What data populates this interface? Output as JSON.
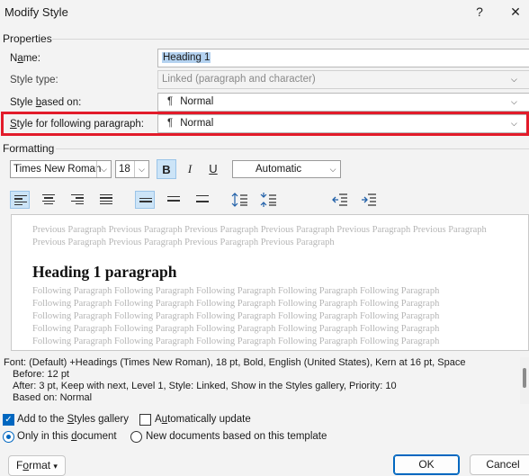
{
  "window": {
    "title": "Modify Style",
    "help_glyph": "?",
    "close_glyph": "✕"
  },
  "properties": {
    "section_label": "Properties",
    "name_label_pre": "N",
    "name_label_u": "a",
    "name_label_post": "me:",
    "name_value": "Heading 1",
    "style_type_label": "Style type:",
    "style_type_value": "Linked (paragraph and character)",
    "based_on_label_pre": "Style ",
    "based_on_label_u": "b",
    "based_on_label_post": "ased on:",
    "based_on_value": "Normal",
    "following_label_pre": "",
    "following_label_u": "S",
    "following_label_post": "tyle for following paragraph:",
    "following_value": "Normal",
    "pilcrow": "¶"
  },
  "formatting": {
    "section_label": "Formatting",
    "font_name": "Times New Roman",
    "font_size": "18",
    "bold": "B",
    "italic": "I",
    "underline": "U",
    "color": "Automatic"
  },
  "preview": {
    "previous_text": "Previous Paragraph Previous Paragraph Previous Paragraph Previous Paragraph Previous Paragraph Previous Paragraph Previous Paragraph Previous Paragraph Previous Paragraph Previous Paragraph",
    "sample_heading": "Heading 1 paragraph",
    "following_lines": [
      "Following Paragraph Following Paragraph Following Paragraph Following Paragraph Following Paragraph",
      "Following Paragraph Following Paragraph Following Paragraph Following Paragraph Following Paragraph",
      "Following Paragraph Following Paragraph Following Paragraph Following Paragraph Following Paragraph",
      "Following Paragraph Following Paragraph Following Paragraph Following Paragraph Following Paragraph",
      "Following Paragraph Following Paragraph Following Paragraph Following Paragraph Following Paragraph"
    ]
  },
  "description": {
    "line1": "Font: (Default) +Headings (Times New Roman), 18 pt, Bold, English (United States), Kern at 16 pt, Space",
    "line2": "Before:  12 pt",
    "line3": "After:  3 pt, Keep with next, Level 1, Style: Linked, Show in the Styles gallery, Priority: 10",
    "line4": "Based on: Normal"
  },
  "options": {
    "add_gallery_pre": "Add to the ",
    "add_gallery_u": "S",
    "add_gallery_post": "tyles gallery",
    "auto_update_pre": "A",
    "auto_update_u": "u",
    "auto_update_post": "tomatically update",
    "only_doc_pre": "Only in this ",
    "only_doc_u": "d",
    "only_doc_post": "ocument",
    "new_docs": "New documents based on this template"
  },
  "buttons": {
    "format_pre": "F",
    "format_u": "o",
    "format_post": "rmat",
    "format_arrow": "▾",
    "ok": "OK",
    "cancel": "Cancel"
  },
  "icons": {
    "dropdown": "⌵",
    "combo_arrow": "⌵"
  },
  "colors": {
    "accent": "#0067c0",
    "highlight_border": "#e21b2a",
    "active_button": "#cce4f7"
  }
}
